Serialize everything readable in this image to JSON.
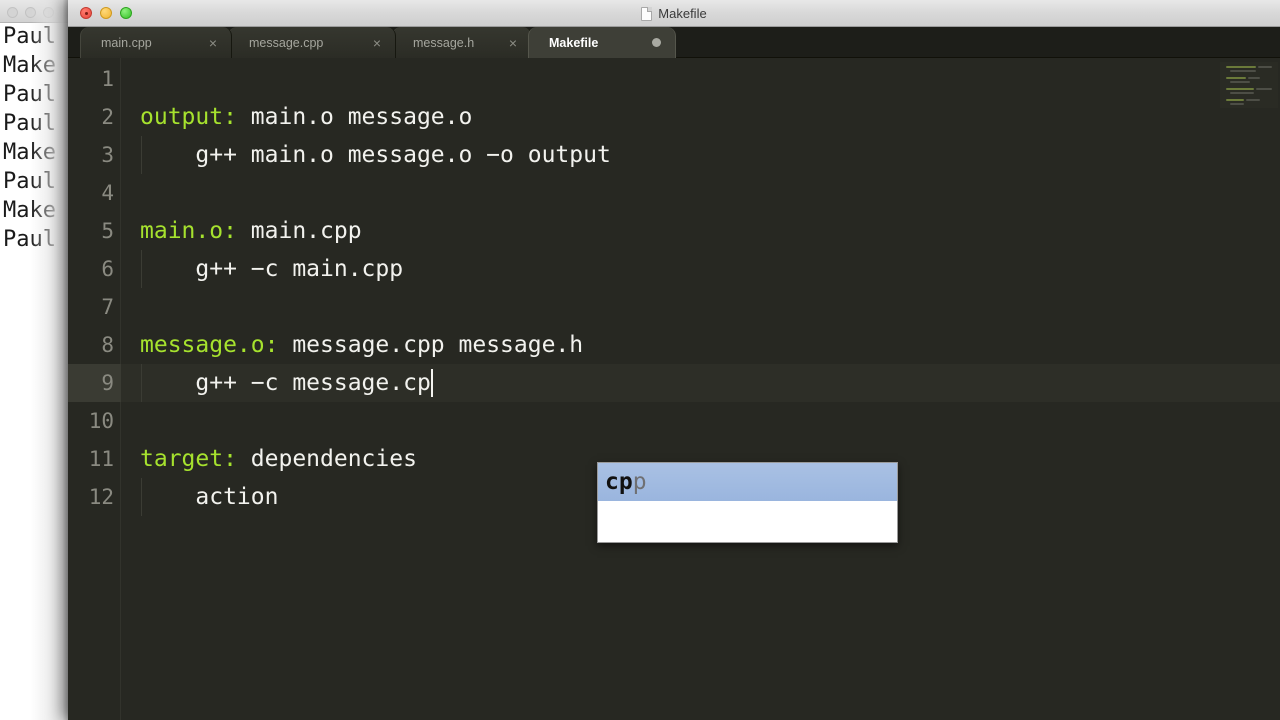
{
  "background_window": {
    "lines": [
      "Paul",
      "Make",
      "Paul",
      "Paul",
      "Make",
      "Paul",
      "Make",
      "Paul"
    ]
  },
  "window": {
    "title": "Makefile",
    "traffic_lights": {
      "close": "close-button",
      "minimize": "minimize-button",
      "maximize": "maximize-button"
    }
  },
  "tabs": [
    {
      "label": "main.cpp",
      "close": "×",
      "active": false,
      "modified": false
    },
    {
      "label": "message.cpp",
      "close": "×",
      "active": false,
      "modified": false
    },
    {
      "label": "message.h",
      "close": "×",
      "active": false,
      "modified": false
    },
    {
      "label": "Makefile",
      "close": "",
      "active": true,
      "modified": true
    }
  ],
  "editor": {
    "active_line": 9,
    "cursor_line": 9,
    "lines": [
      {
        "num": "1",
        "segments": []
      },
      {
        "num": "2",
        "segments": [
          {
            "text": "output:",
            "type": "target"
          },
          {
            "text": " main.o message.o",
            "type": "plain"
          }
        ]
      },
      {
        "num": "3",
        "segments": [
          {
            "text": "    g++ main.o message.o −o output",
            "type": "plain"
          }
        ]
      },
      {
        "num": "4",
        "segments": []
      },
      {
        "num": "5",
        "segments": [
          {
            "text": "main.o:",
            "type": "target"
          },
          {
            "text": " main.cpp",
            "type": "plain"
          }
        ]
      },
      {
        "num": "6",
        "segments": [
          {
            "text": "    g++ −c main.cpp",
            "type": "plain"
          }
        ]
      },
      {
        "num": "7",
        "segments": []
      },
      {
        "num": "8",
        "segments": [
          {
            "text": "message.o:",
            "type": "target"
          },
          {
            "text": " message.cpp message.h",
            "type": "plain"
          }
        ]
      },
      {
        "num": "9",
        "segments": [
          {
            "text": "    g++ −c message.cp",
            "type": "plain"
          }
        ]
      },
      {
        "num": "10",
        "segments": []
      },
      {
        "num": "11",
        "segments": [
          {
            "text": "target:",
            "type": "target"
          },
          {
            "text": " dependencies",
            "type": "plain"
          }
        ]
      },
      {
        "num": "12",
        "segments": [
          {
            "text": "    action",
            "type": "plain"
          }
        ]
      }
    ],
    "colors": {
      "background": "#272822",
      "foreground": "#f2f2ee",
      "target": "#a6e22e",
      "line_number": "#8a8a81",
      "active_line": "#2d2e27"
    }
  },
  "autocomplete": {
    "items": [
      {
        "matched": "cp",
        "rest": "p",
        "selected": true
      },
      {
        "matched": "",
        "rest": "",
        "selected": false
      }
    ],
    "highlight_color": "#9ab5de"
  }
}
